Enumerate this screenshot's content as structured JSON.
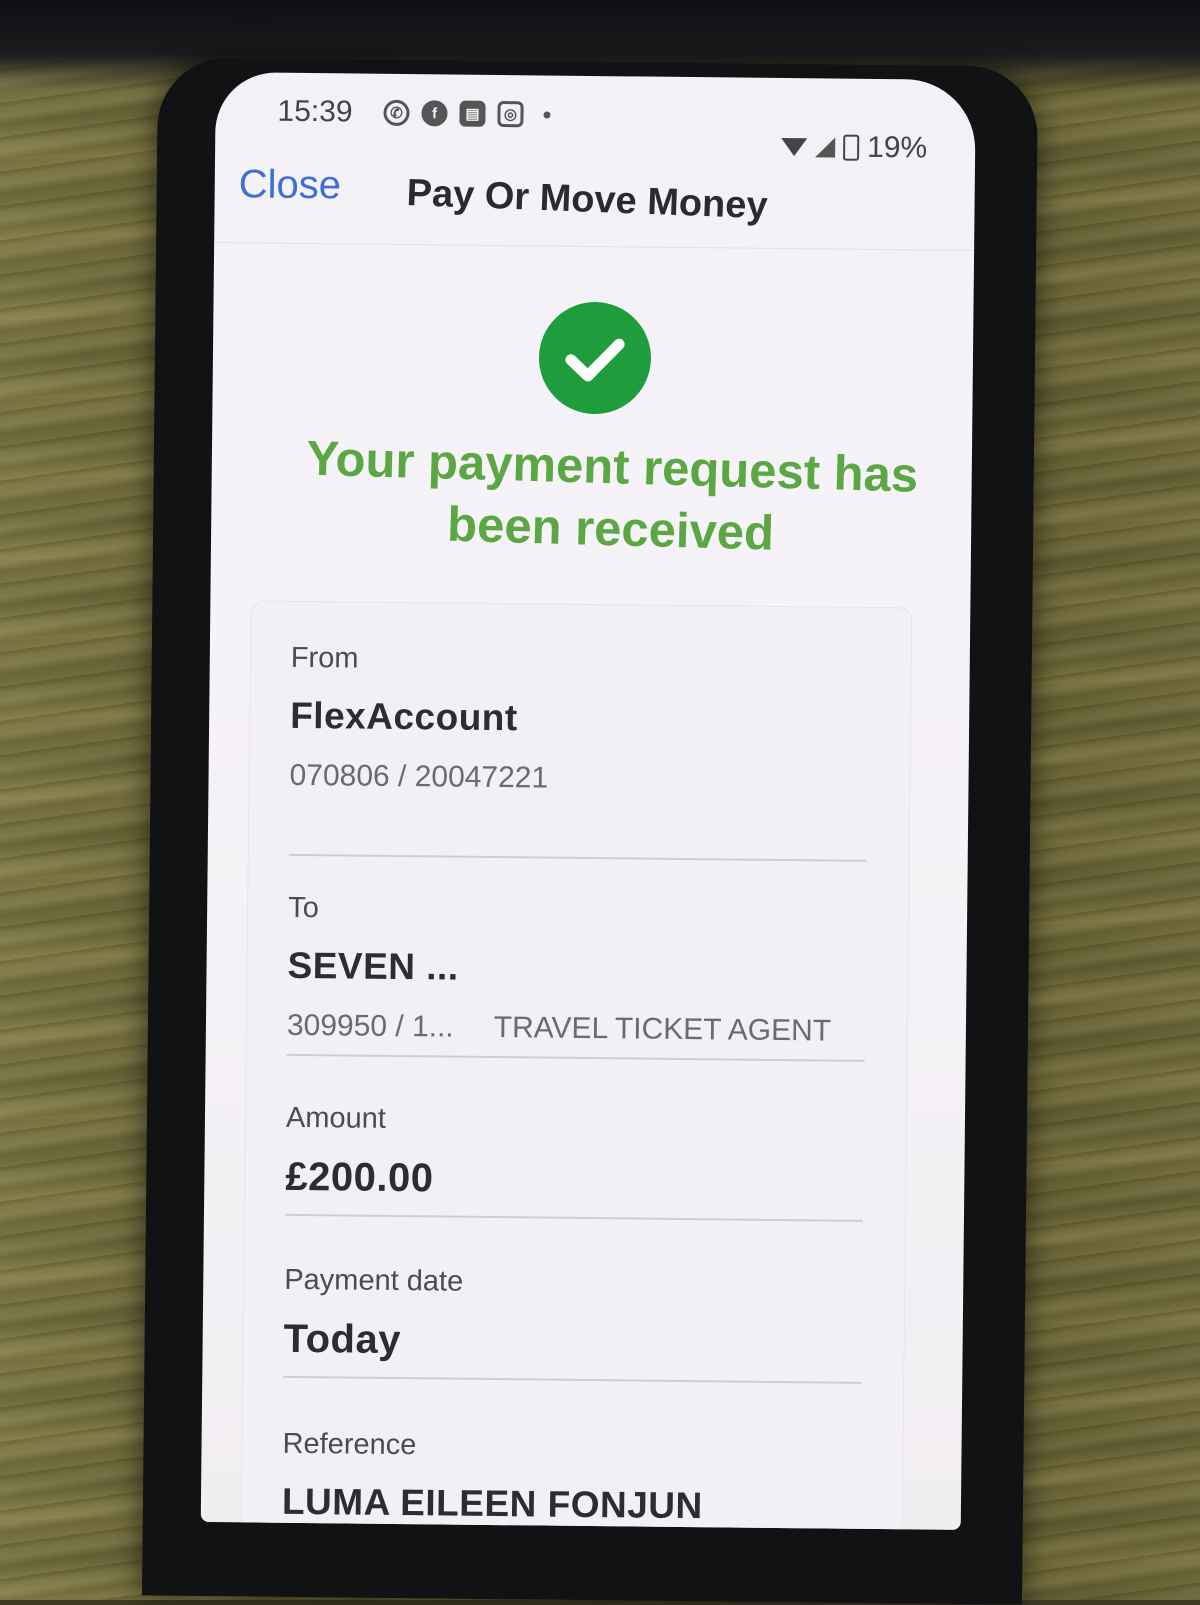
{
  "status_bar": {
    "time": "15:39",
    "battery": "19%",
    "notification_icons": [
      "whatsapp-icon",
      "facebook-icon",
      "news-icon",
      "instagram-icon"
    ]
  },
  "header": {
    "close_label": "Close",
    "title": "Pay Or Move Money"
  },
  "success": {
    "icon": "check-circle-icon",
    "message": "Your payment request has been received",
    "color": "#1f9d3d",
    "text_color": "#5aa743"
  },
  "details": {
    "from": {
      "label": "From",
      "account_name": "FlexAccount",
      "account_number": "070806 / 20047221"
    },
    "to": {
      "label": "To",
      "payee_name": "SEVEN ...",
      "payee_account": "309950 / 1...",
      "payee_type": "TRAVEL TICKET AGENT"
    },
    "amount": {
      "label": "Amount",
      "value": "£200.00"
    },
    "payment_date": {
      "label": "Payment date",
      "value": "Today"
    },
    "reference": {
      "label": "Reference",
      "value": "LUMA EILEEN FONJUN"
    }
  },
  "colors": {
    "link": "#3f6fd3",
    "screen_bg": "#f3f1f7"
  }
}
